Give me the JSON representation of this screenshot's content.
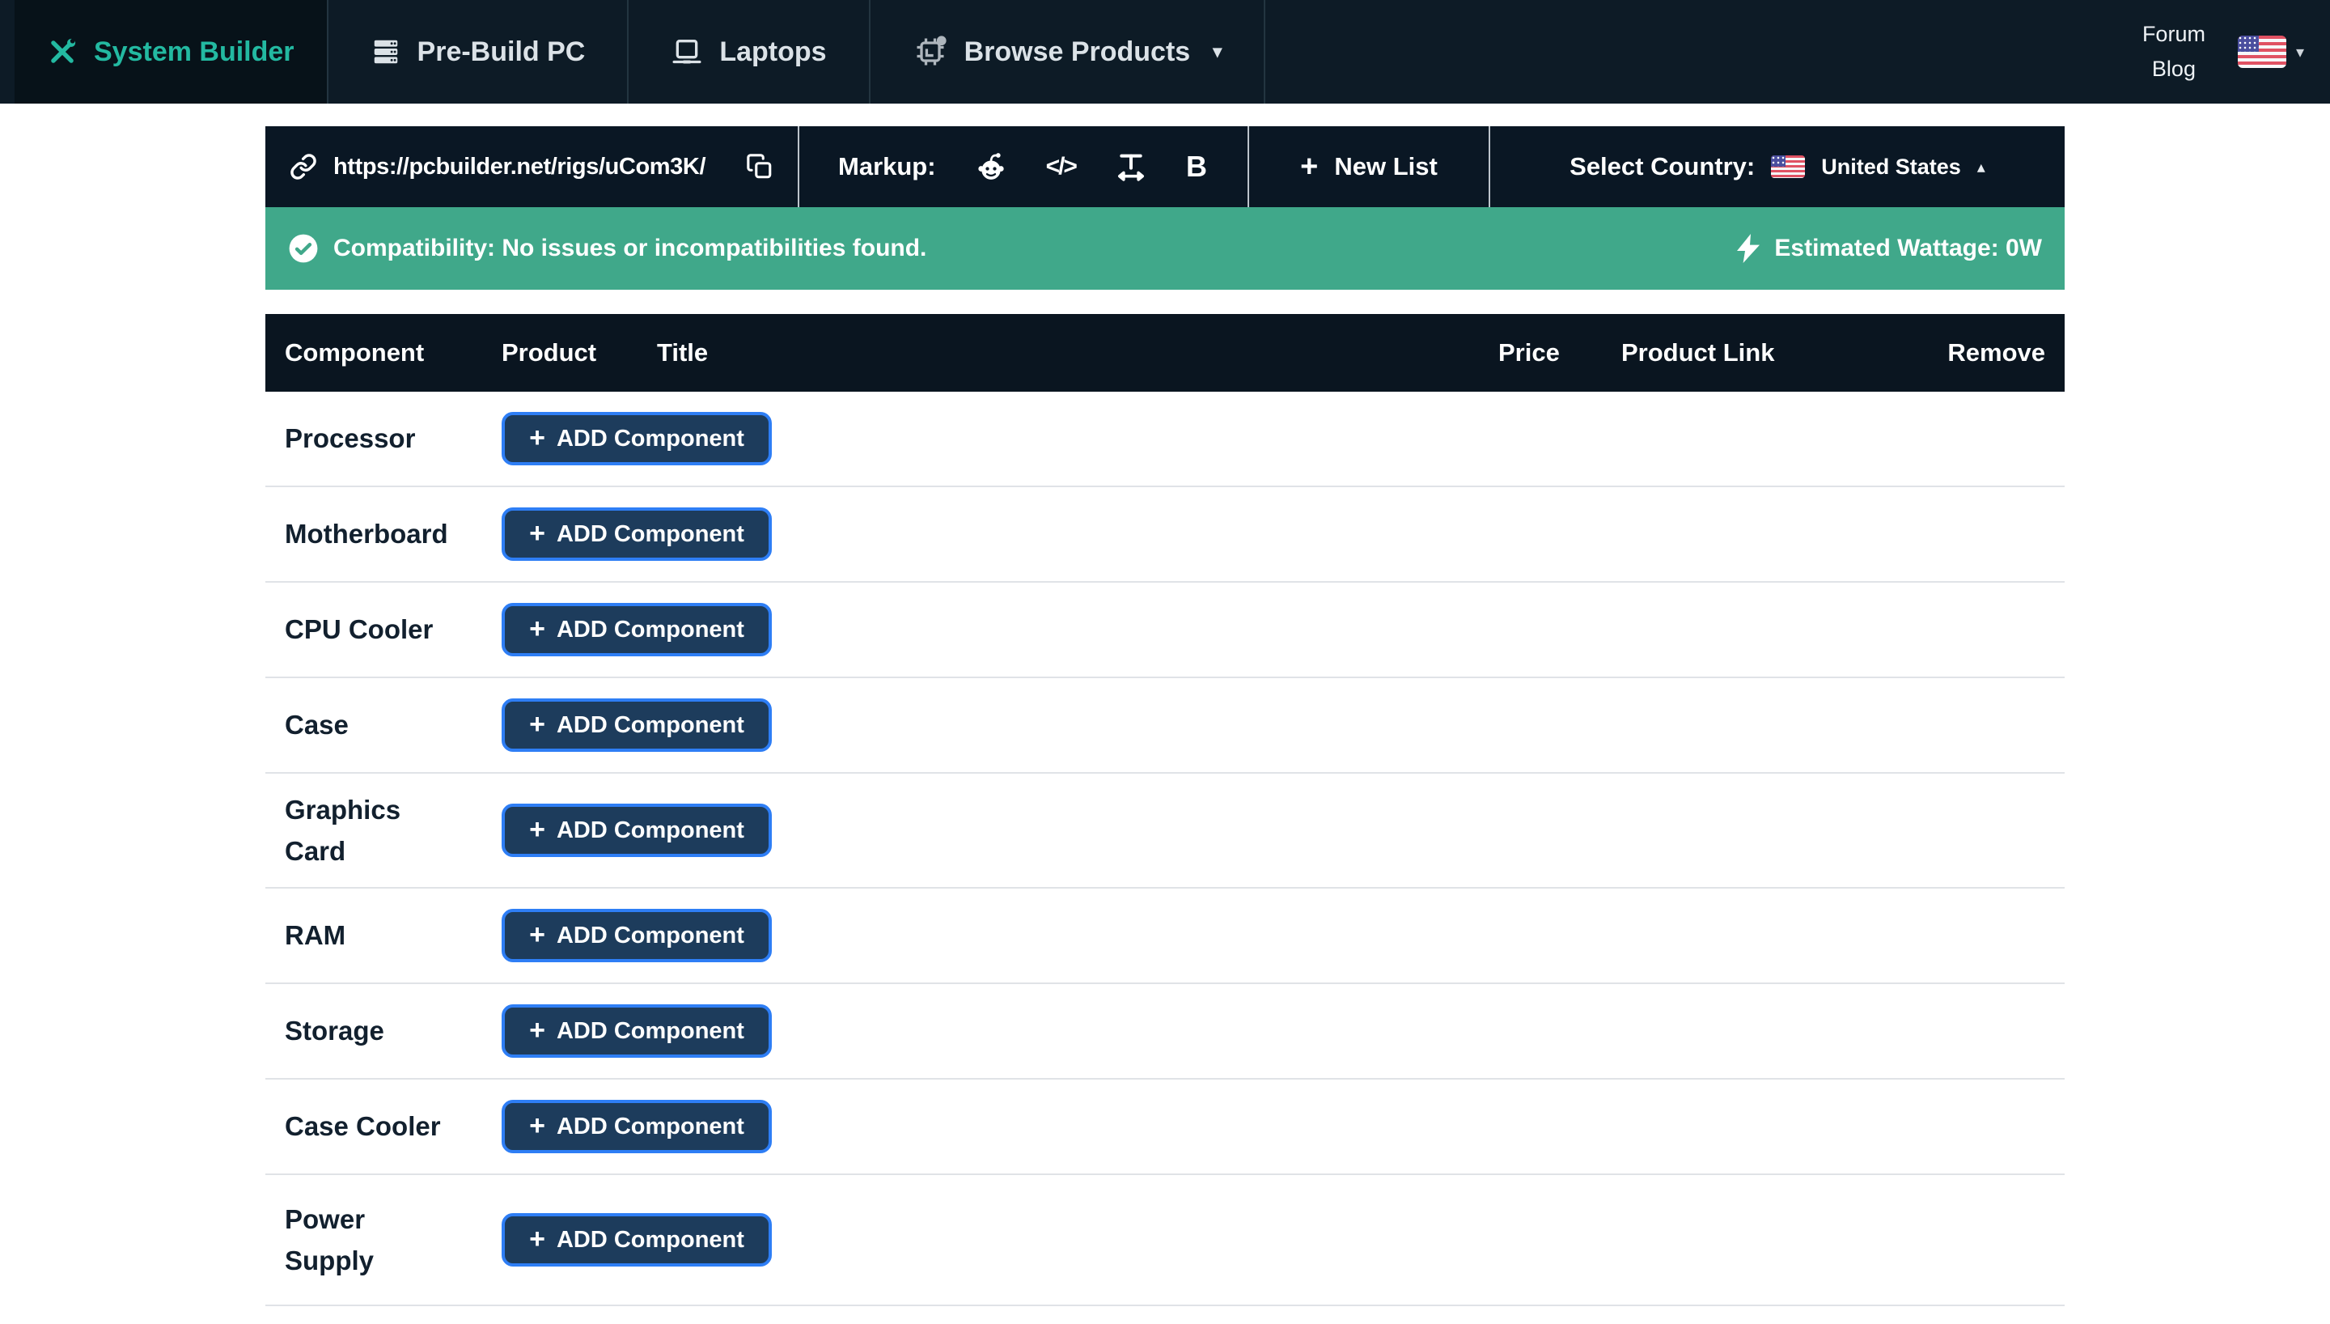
{
  "nav": {
    "items": [
      {
        "label": "System Builder",
        "active": true
      },
      {
        "label": "Pre-Build PC"
      },
      {
        "label": "Laptops"
      },
      {
        "label": "Browse Products"
      }
    ],
    "forum": "Forum",
    "blog": "Blog"
  },
  "toolbar": {
    "url": "https://pcbuilder.net/rigs/uCom3K/",
    "markup_label": "Markup:",
    "new_list": "New List",
    "select_country": "Select Country:",
    "country": "United States"
  },
  "banner": {
    "compatibility": "Compatibility: No issues or incompatibilities found.",
    "wattage": "Estimated Wattage: 0W"
  },
  "table": {
    "headers": [
      "Component",
      "Product",
      "Title",
      "Price",
      "Product Link",
      "Remove"
    ],
    "add_button_label": "ADD Component",
    "rows": [
      {
        "component": "Processor"
      },
      {
        "component": "Motherboard"
      },
      {
        "component": "CPU Cooler"
      },
      {
        "component": "Case"
      },
      {
        "component": "Graphics\nCard"
      },
      {
        "component": "RAM"
      },
      {
        "component": "Storage"
      },
      {
        "component": "Case Cooler"
      },
      {
        "component": "Power\nSupply"
      }
    ]
  },
  "glyphs": {
    "plus": "+",
    "code": "</>",
    "bold": "B",
    "caret_down": "▾",
    "caret_up": "▴"
  },
  "colors": {
    "teal_accent": "#23b9a1",
    "nav_bg": "#0d1b26",
    "toolbar_bg": "#0a1724",
    "banner_green": "#40a88a",
    "table_header_bg": "#0a1520",
    "button_bg": "#1d3c5c",
    "button_border": "#2e7ef5"
  }
}
